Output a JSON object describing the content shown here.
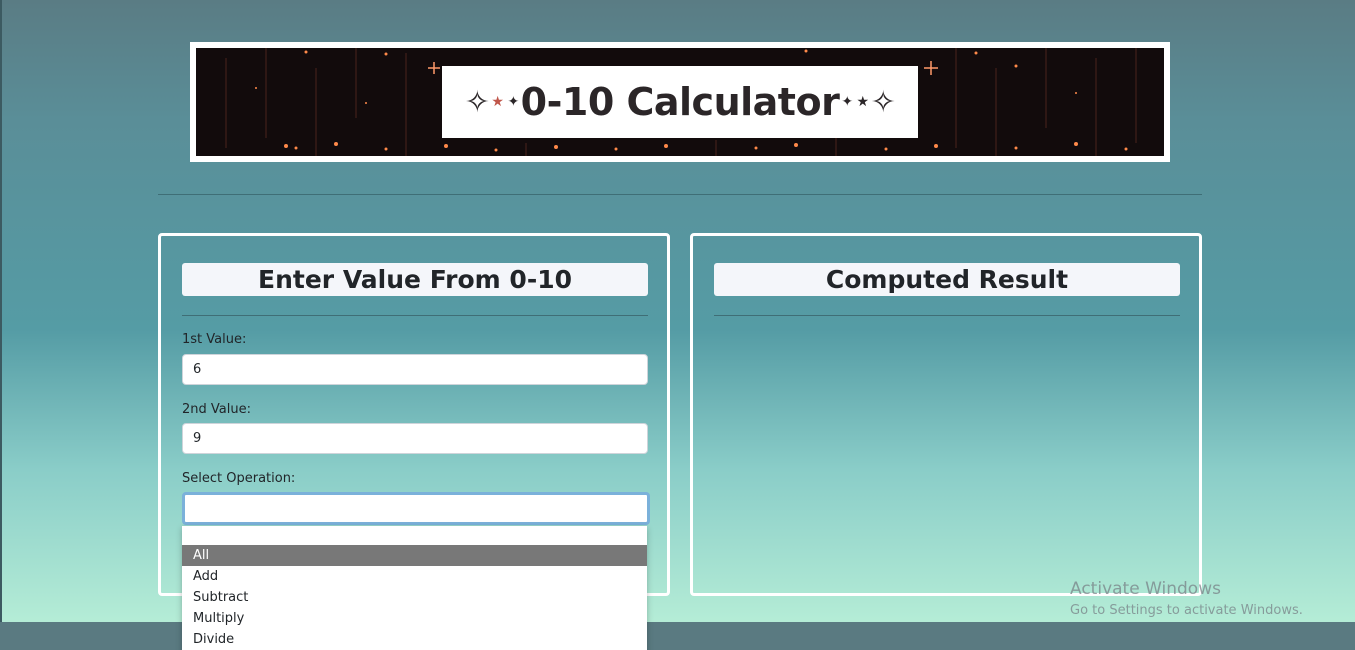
{
  "banner": {
    "title": "0-10 Calculator",
    "spark_glyph": "✧",
    "small_star": "✦",
    "red_star": "★"
  },
  "input_panel": {
    "heading": "Enter Value From 0-10",
    "first_label": "1st Value:",
    "first_value": "6",
    "second_label": "2nd Value:",
    "second_value": "9",
    "operation_label": "Select Operation:",
    "operation_value": ""
  },
  "result_panel": {
    "heading": "Computed Result"
  },
  "operation_options": [
    {
      "label": "All",
      "selected": true
    },
    {
      "label": "Add",
      "selected": false
    },
    {
      "label": "Subtract",
      "selected": false
    },
    {
      "label": "Multiply",
      "selected": false
    },
    {
      "label": "Divide",
      "selected": false
    }
  ],
  "watermark": {
    "title": "Activate Windows",
    "subtitle": "Go to Settings to activate Windows."
  },
  "colors": {
    "panel_border": "#ffffff",
    "heading_bg": "#f4f6fa",
    "selected_option": "#787878",
    "select_focus": "#7bb1da",
    "footer": "#5a7a81"
  }
}
